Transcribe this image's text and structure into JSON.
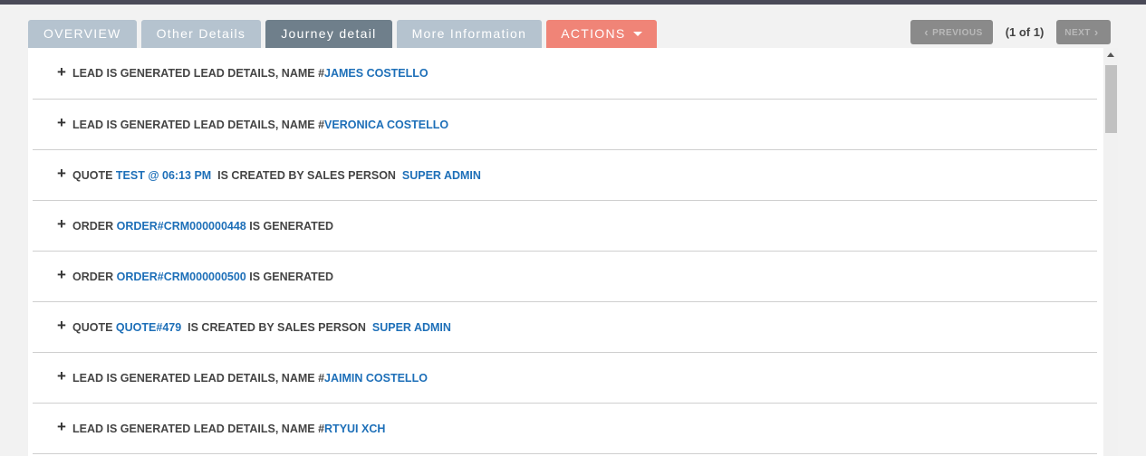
{
  "tabs": [
    {
      "label": "OVERVIEW"
    },
    {
      "label": "Other Details"
    },
    {
      "label": "Journey detail"
    },
    {
      "label": "More Information"
    },
    {
      "label": "ACTIONS"
    }
  ],
  "pager": {
    "previous_label": "PREVIOUS",
    "next_label": "NEXT",
    "info": "(1 of 1)"
  },
  "journey": [
    {
      "pre": "LEAD IS GENERATED LEAD DETAILS, NAME #",
      "link1": "JAMES COSTELLO",
      "mid": "",
      "link2": ""
    },
    {
      "pre": "LEAD IS GENERATED LEAD DETAILS, NAME #",
      "link1": "VERONICA COSTELLO",
      "mid": "",
      "link2": ""
    },
    {
      "pre": "QUOTE ",
      "link1": "TEST @ 06:13 PM",
      "mid": "  IS CREATED BY SALES PERSON  ",
      "link2": "SUPER ADMIN"
    },
    {
      "pre": "ORDER ",
      "link1": "ORDER#CRM000000448",
      "mid": " IS GENERATED",
      "link2": ""
    },
    {
      "pre": "ORDER ",
      "link1": "ORDER#CRM000000500",
      "mid": " IS GENERATED",
      "link2": ""
    },
    {
      "pre": "QUOTE ",
      "link1": "QUOTE#479",
      "mid": "  IS CREATED BY SALES PERSON  ",
      "link2": "SUPER ADMIN"
    },
    {
      "pre": "LEAD IS GENERATED LEAD DETAILS, NAME #",
      "link1": "JAIMIN COSTELLO",
      "mid": "",
      "link2": ""
    },
    {
      "pre": "LEAD IS GENERATED LEAD DETAILS, NAME #",
      "link1": "RTYUI XCH",
      "mid": "",
      "link2": ""
    }
  ],
  "expand_symbol": "+",
  "colors": {
    "tab_inactive": "#b5c3cf",
    "tab_active": "#6f7f8b",
    "actions": "#f08477",
    "link": "#1d6fb8"
  }
}
